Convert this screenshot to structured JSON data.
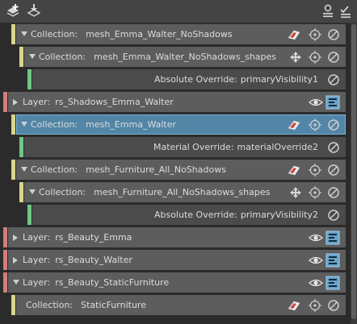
{
  "rows": [
    {
      "kind": "collection",
      "prefix": "Collection:",
      "name": "mesh_Emma_Walter_NoShadows"
    },
    {
      "kind": "collection",
      "prefix": "Collection:",
      "name": "mesh_Emma_Walter_NoShadows_shapes"
    },
    {
      "kind": "override",
      "prefix": "Absolute Override:",
      "name": "primaryVisibility1"
    },
    {
      "kind": "layer",
      "prefix": "Layer:",
      "name": "rs_Shadows_Emma_Walter"
    },
    {
      "kind": "collection",
      "prefix": "Collection:",
      "name": "mesh_Emma_Walter",
      "selected": true
    },
    {
      "kind": "override",
      "prefix": "Material Override:",
      "name": "materialOverride2"
    },
    {
      "kind": "collection",
      "prefix": "Collection:",
      "name": "mesh_Furniture_All_NoShadows"
    },
    {
      "kind": "collection",
      "prefix": "Collection:",
      "name": "mesh_Furniture_All_NoShadows_shapes"
    },
    {
      "kind": "override",
      "prefix": "Absolute Override:",
      "name": "primaryVisibility2"
    },
    {
      "kind": "layer",
      "prefix": "Layer:",
      "name": "rs_Beauty_Emma"
    },
    {
      "kind": "layer",
      "prefix": "Layer:",
      "name": "rs_Beauty_Walter"
    },
    {
      "kind": "layer",
      "prefix": "Layer:",
      "name": "rs_Beauty_StaticFurniture"
    },
    {
      "kind": "collection",
      "prefix": "Collection:",
      "name": "StaticFurniture"
    }
  ],
  "colors": {
    "layer_stripe": "#d47c7c",
    "collection_stripe": "#d8d48a",
    "override_stripe": "#6fc785",
    "selected": "#5285a6"
  },
  "icons": [
    "create-layer-icon",
    "import-icon",
    "render-settings-icon",
    "ai-override-icon"
  ]
}
